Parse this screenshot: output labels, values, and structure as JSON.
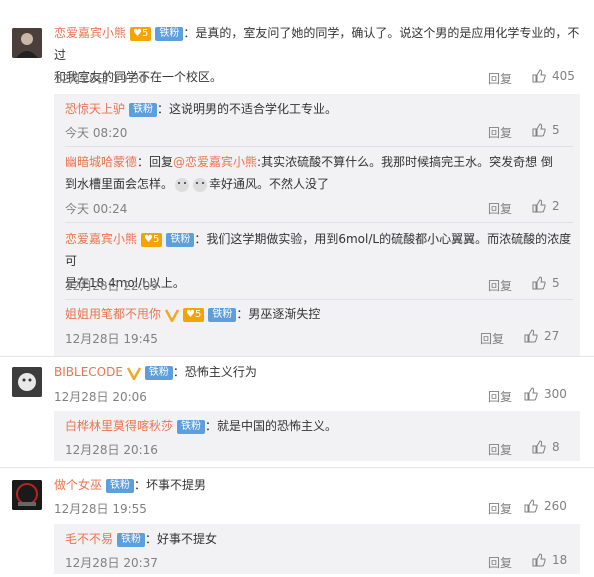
{
  "comments": [
    {
      "user": "恋爱嘉宾小熊",
      "badges": [
        "铁粉"
      ],
      "text_line1": "：是真的，室友问了她的同学，确认了。说这个男的是应用化学专业的，不过",
      "text_line2": "和我室友的同学不在一个校区。",
      "time": "12月28日 19:30",
      "reply": "回复",
      "likes": "405",
      "replies": [
        {
          "user": "恐惊天上驴",
          "badge": "铁粉",
          "text": "：这说明男的不适合学化工专业。",
          "time": "今天 08:20",
          "reply": "回复",
          "likes": "5"
        },
        {
          "user": "幽暗城哈蒙德",
          "text_pre": "：回复",
          "mention": "@恋爱嘉宾小熊",
          "text_line1": ":其实浓硫酸不算什么。我那时候搞完王水。突发奇想 倒",
          "text_line2_a": "到水槽里面会怎样。",
          "text_line2_b": "幸好通风。不然人没了",
          "time": "今天 00:24",
          "reply": "回复",
          "likes": "2"
        },
        {
          "user": "恋爱嘉宾小熊",
          "badge": "铁粉",
          "text_line1": "：我们这学期做实验，用到6mol/L的硫酸都小心翼翼。而浓硫酸的浓度可",
          "text_line2": "是在18.4mol/L以上。",
          "time": "12月28日 22:09",
          "reply": "回复",
          "likes": "5"
        },
        {
          "user": "姐姐用笔都不甩你",
          "badge": "铁粉",
          "text": "：男巫逐渐失控",
          "time": "12月28日 19:45",
          "reply": "回复",
          "likes": "27"
        }
      ]
    },
    {
      "user": "BIBLECODE",
      "badge": "铁粉",
      "text": "：恐怖主义行为",
      "time": "12月28日 20:06",
      "reply": "回复",
      "likes": "300",
      "replies": [
        {
          "user": "白桦林里莫得喀秋莎",
          "badge": "铁粉",
          "text": "：就是中国的恐怖主义。",
          "time": "12月28日 20:16",
          "reply": "回复",
          "likes": "8"
        }
      ]
    },
    {
      "user": "做个女巫",
      "badge": "铁粉",
      "text": "：坏事不提男",
      "time": "12月28日 19:55",
      "reply": "回复",
      "likes": "260",
      "replies": [
        {
          "user": "毛不不易",
          "badge": "铁粉",
          "text": "：好事不提女",
          "time": "12月28日 20:37",
          "reply": "回复",
          "likes": "18"
        }
      ]
    }
  ],
  "colors": {
    "name": "#eb7350",
    "badge": "#5d9edc",
    "subbg": "#f2f2f5",
    "meta": "#808080"
  }
}
